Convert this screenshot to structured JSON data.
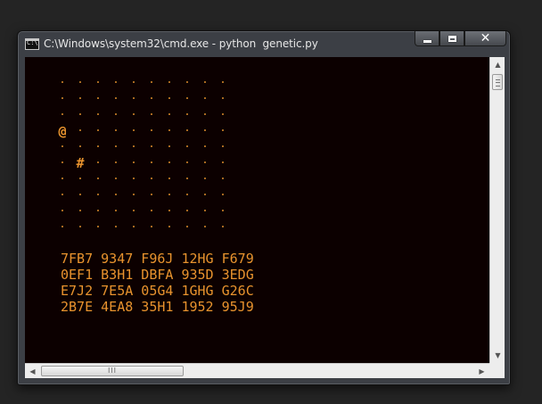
{
  "window": {
    "title": "C:\\Windows\\system32\\cmd.exe - python  genetic.py",
    "icon": "cmd-icon",
    "icon_text": "C:\\",
    "minimize_glyph": "",
    "maximize_glyph": "",
    "close_glyph": "✕"
  },
  "console": {
    "text_color": "#e8932e",
    "background": "#0c0000",
    "board": {
      "rows": [
        [
          ".",
          ".",
          ".",
          ".",
          ".",
          ".",
          ".",
          ".",
          ".",
          "."
        ],
        [
          ".",
          ".",
          ".",
          ".",
          ".",
          ".",
          ".",
          ".",
          ".",
          "."
        ],
        [
          ".",
          ".",
          ".",
          ".",
          ".",
          ".",
          ".",
          ".",
          ".",
          "."
        ],
        [
          "@",
          ".",
          ".",
          ".",
          ".",
          ".",
          ".",
          ".",
          ".",
          "."
        ],
        [
          ".",
          ".",
          ".",
          ".",
          ".",
          ".",
          ".",
          ".",
          ".",
          "."
        ],
        [
          ".",
          "#",
          ".",
          ".",
          ".",
          ".",
          ".",
          ".",
          ".",
          "."
        ],
        [
          ".",
          ".",
          ".",
          ".",
          ".",
          ".",
          ".",
          ".",
          ".",
          "."
        ],
        [
          ".",
          ".",
          ".",
          ".",
          ".",
          ".",
          ".",
          ".",
          ".",
          "."
        ],
        [
          ".",
          ".",
          ".",
          ".",
          ".",
          ".",
          ".",
          ".",
          ".",
          "."
        ],
        [
          ".",
          ".",
          ".",
          ".",
          ".",
          ".",
          ".",
          ".",
          ".",
          "."
        ]
      ]
    },
    "codes": [
      "7FB7 9347 F96J 12HG F679",
      "0EF1 B3H1 DBFA 935D 3EDG",
      "E7J2 7E5A 05G4 1GHG G26C",
      "2B7E 4EA8 35H1 1952 95J9"
    ]
  },
  "scrollbars": {
    "up_arrow": "▲",
    "down_arrow": "▼",
    "left_arrow": "◀",
    "right_arrow": "▶",
    "hthumb_grip": "III"
  }
}
